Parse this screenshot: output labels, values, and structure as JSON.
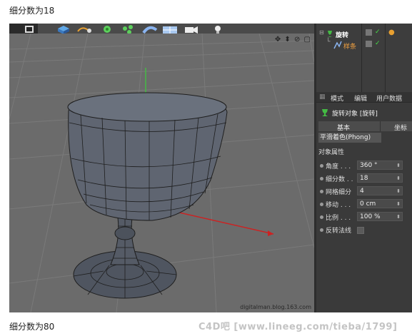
{
  "captions": {
    "top": "细分数为18",
    "bottom": "细分数为80"
  },
  "watermark": "C4D吧 [www.lineeg.com/tieba/1799]",
  "viewport": {
    "nav_icons": "✥ ⬍ ⊘ ▢",
    "credit": "digitalman.blog.163.com"
  },
  "object_manager": {
    "objects": [
      {
        "name": "旋转",
        "icon": "lathe-icon",
        "color": "#ffffff"
      },
      {
        "name": "样条",
        "icon": "spline-icon",
        "color": "#f0a040"
      }
    ]
  },
  "attributes": {
    "tabs": [
      "模式",
      "编辑",
      "用户数据"
    ],
    "title": "旋转对象 [旋转]",
    "subtabs": [
      "基本",
      "坐标"
    ],
    "shading_tag": "平滑着色(Phong)",
    "section": "对象属性",
    "params": [
      {
        "label": "角度 . . .",
        "value": "360 °"
      },
      {
        "label": "细分数 . .",
        "value": "18"
      },
      {
        "label": "网格细分",
        "value": "4"
      },
      {
        "label": "移动 . . .",
        "value": "0 cm"
      },
      {
        "label": "比例 . . .",
        "value": "100 %"
      }
    ],
    "flip_normals_label": "反转法线"
  },
  "colors": {
    "viewport_bg": "#6b6b6b",
    "panel_bg": "#3a3a3a",
    "accent_green": "#44bb44",
    "axis_red": "#cc2222"
  }
}
